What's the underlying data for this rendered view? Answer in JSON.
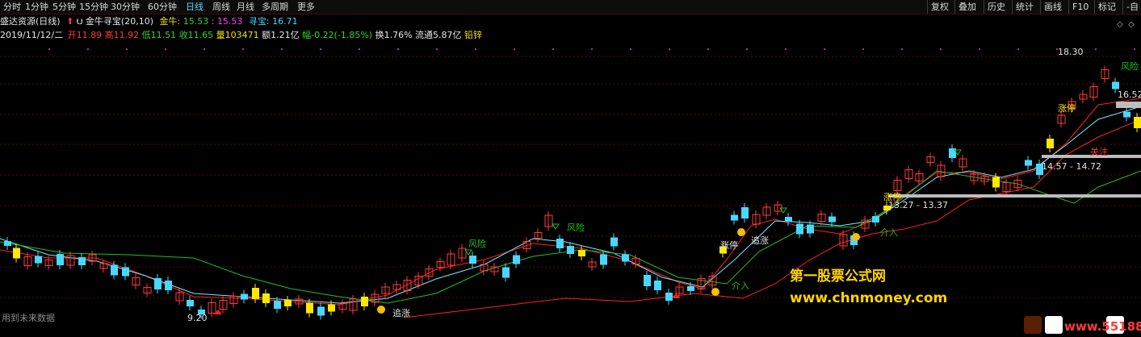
{
  "toolbar": {
    "periods": [
      "分时",
      "1分钟",
      "5分钟",
      "15分钟",
      "30分钟",
      "60分钟",
      "日线",
      "周线",
      "月线",
      "多周期",
      "更多"
    ],
    "active_period": "日线",
    "right_buttons": [
      "复权",
      "叠加",
      "历史",
      "统计",
      "画线",
      "F10",
      "标记",
      "-自"
    ]
  },
  "header": {
    "stock_title": "盛达资源(日线)",
    "indicator_name": "金牛寻宝(20,10)",
    "jinniu_label": "金牛:",
    "jinniu_values": "15.53",
    "jinniu_colon": ":",
    "jinniu_value2": "15.53",
    "xunbao_label": "寻宝:",
    "xunbao_value": "16.71"
  },
  "quote": {
    "date": "2019/11/12/二",
    "open_label": "开",
    "open": "11.89",
    "high_label": "高",
    "high": "11.92",
    "low_label": "低",
    "low": "11.51",
    "close_label": "收",
    "close": "11.65",
    "volume_label": "量",
    "volume": "103471",
    "amount_label": "额",
    "amount": "1.21亿",
    "change_label": "幅",
    "change": "-0.22(-1.85%)",
    "turnover_label": "换",
    "turnover": "1.76%",
    "float_label": "流通",
    "float": "5.87亿",
    "sector": "铅锌"
  },
  "annotations": {
    "price_high": "18.30",
    "price_right": "16.52",
    "price_low": "9.20",
    "range1": "14.57 - 14.72",
    "range2": "13.27 - 13.37",
    "risk": "风险",
    "zhangting": "涨停",
    "zhuizhang": "追涨",
    "jieru": "介入",
    "guanzhu": "关注"
  },
  "colors": {
    "up": "#ff3a3a",
    "down": "#48d8ff",
    "limit": "#ffe800",
    "ma_red": "#ff2020",
    "ma_cyan": "#7fe6ff",
    "ma_green": "#20c020"
  },
  "watermark": {
    "line1": "第一股票公式网",
    "line2": "www.chnmoney.com",
    "corner": "www.55188"
  },
  "future_text": "用到未来数据"
}
